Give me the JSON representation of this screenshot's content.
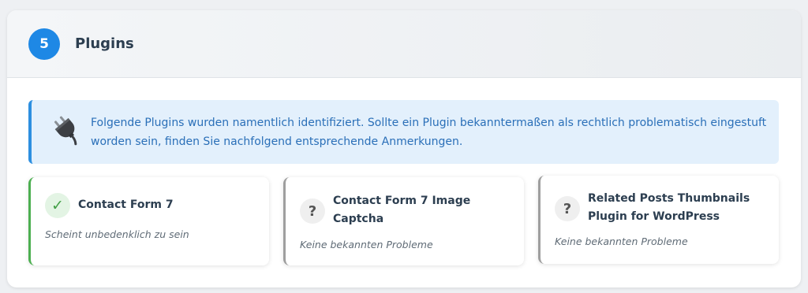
{
  "section": {
    "step_number": "5",
    "title": "Plugins"
  },
  "info": {
    "icon": "electric-plug-icon",
    "text": "Folgende Plugins wurden namentlich identifiziert. Sollte ein Plugin bekanntermaßen als rechtlich problematisch eingestuft worden sein, finden Sie nachfolgend entsprechende Anmerkungen."
  },
  "plugins": [
    {
      "name": "Contact Form 7",
      "status_icon": "✓",
      "status": "Scheint unbedenklich zu sein",
      "accent_color": "#4caf50"
    },
    {
      "name": "Contact Form 7 Image Captcha",
      "status_icon": "?",
      "status": "Keine bekannten Probleme",
      "accent_color": "#9e9e9e"
    },
    {
      "name": "Related Posts Thumbnails Plugin for WordPress",
      "status_icon": "?",
      "status": "Keine bekannten Probleme",
      "accent_color": "#9e9e9e"
    }
  ],
  "colors": {
    "primary": "#1e88e5",
    "info_bg": "#e3f0fc",
    "info_text": "#2a6fb8",
    "ok": "#4caf50",
    "neutral": "#9e9e9e"
  }
}
